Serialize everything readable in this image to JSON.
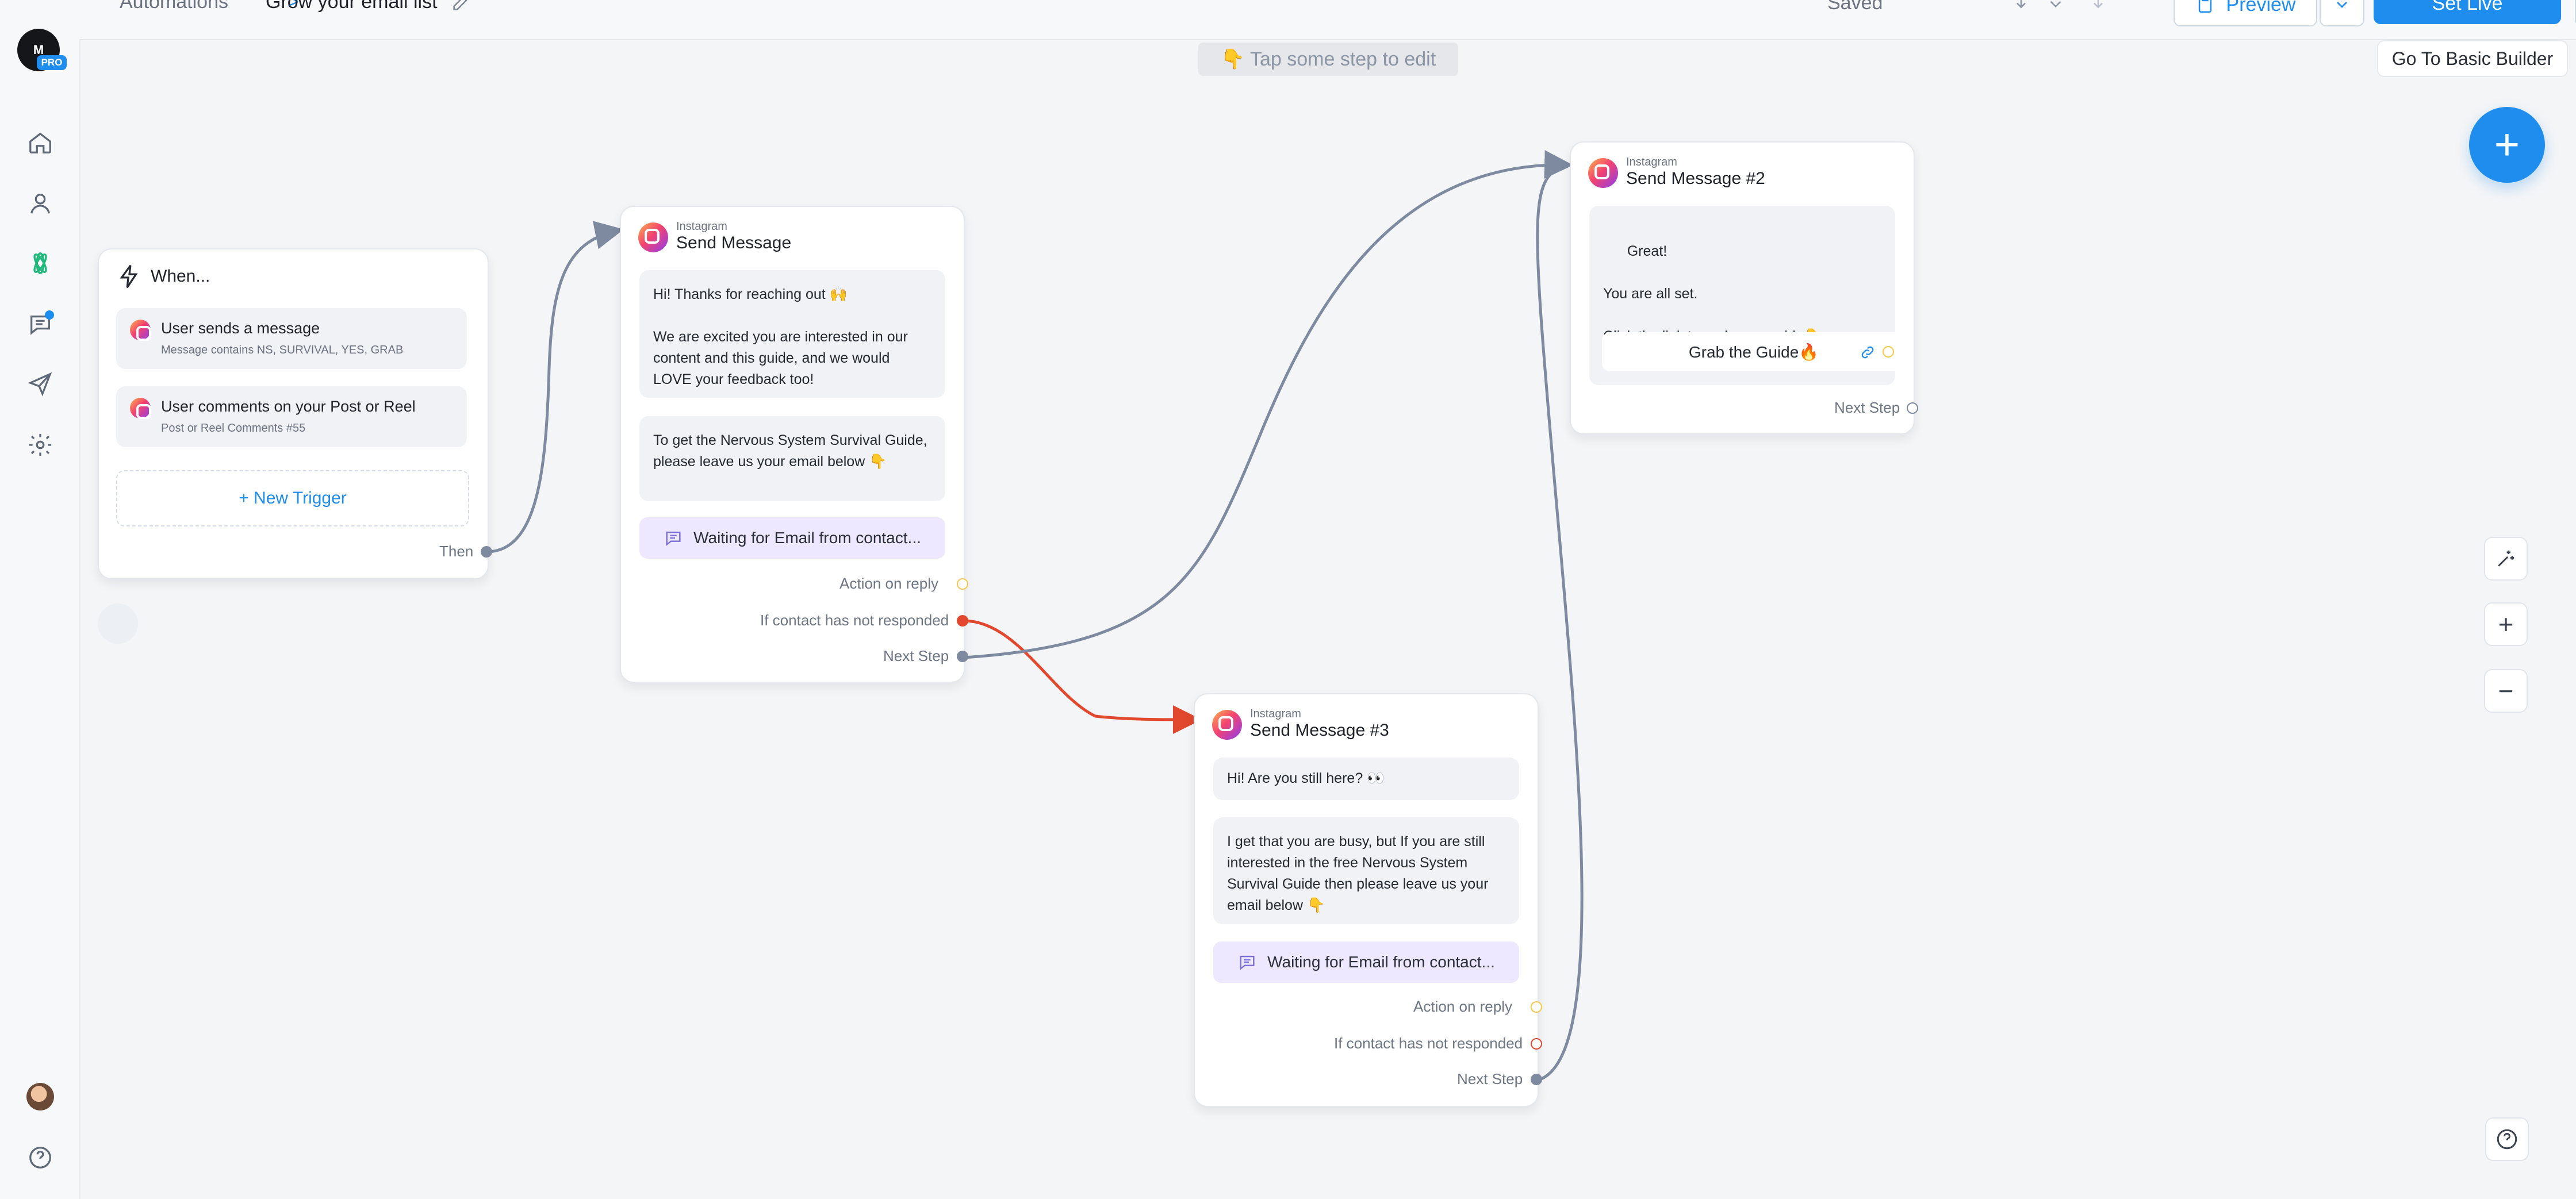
{
  "breadcrumb": {
    "root": "Automations",
    "separator": ">",
    "title": "Grow your email list"
  },
  "header": {
    "saved": "Saved",
    "preview": "Preview",
    "set_live": "Set Live"
  },
  "canvas": {
    "hint": "👇 Tap some step to edit",
    "basic_builder": "Go To Basic Builder"
  },
  "sidebar": {
    "logo_text": "M",
    "pro": "PRO"
  },
  "trigger_card": {
    "title": "When...",
    "items": [
      {
        "title": "User sends a message",
        "subtitle": "Message contains NS, SURVIVAL, YES, GRAB"
      },
      {
        "title": "User comments on your Post or Reel",
        "subtitle": "Post or Reel Comments #55"
      }
    ],
    "new_trigger": "+ New Trigger",
    "then": "Then"
  },
  "card_send_message": {
    "platform": "Instagram",
    "title": "Send Message",
    "messages": [
      "Hi! Thanks for reaching out 🙌\n\nWe are excited you are interested in our content and this guide, and we would LOVE your feedback too!",
      "To get the Nervous System Survival Guide, please leave us your email below 👇"
    ],
    "waiting": "Waiting for Email from contact...",
    "action_on_reply": "Action on reply",
    "not_responded": "If contact has not responded",
    "next_step": "Next Step"
  },
  "card_send_message_2": {
    "platform": "Instagram",
    "title": "Send Message #2",
    "message": "Great!\n\nYou are all set.\n\nClick the link to grab your guide👇",
    "button": "Grab the Guide🔥",
    "next_step": "Next Step"
  },
  "card_send_message_3": {
    "platform": "Instagram",
    "title": "Send Message #3",
    "messages": [
      "Hi! Are you still here? 👀",
      "I get that you are busy, but If you are still interested in the free Nervous System Survival Guide then please leave us your email below 👇"
    ],
    "waiting": "Waiting for Email from contact...",
    "action_on_reply": "Action on reply",
    "not_responded": "If contact has not responded",
    "next_step": "Next Step"
  },
  "tools": {
    "zoom_in": "+",
    "zoom_out": "−",
    "add": "+"
  },
  "colors": {
    "accent": "#1f8ded",
    "connector": "#7d8aa0",
    "warning": "#f2b319",
    "error": "#e1482d"
  }
}
